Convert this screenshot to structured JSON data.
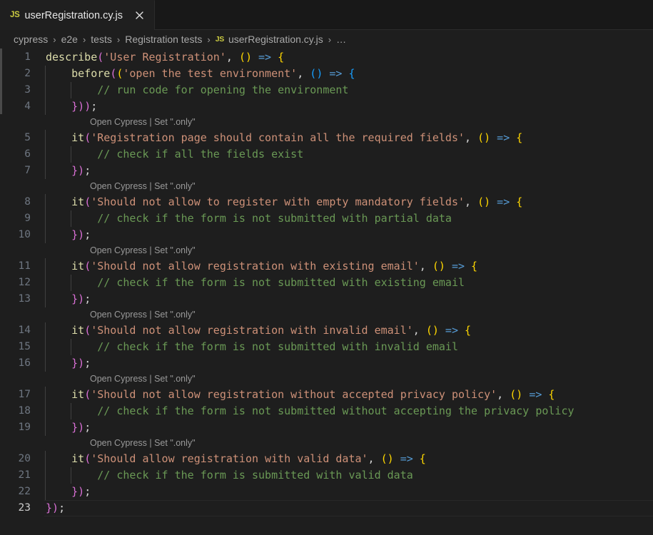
{
  "tab": {
    "icon": "js-file-icon",
    "label": "userRegistration.cy.js",
    "close_icon": "close-icon"
  },
  "breadcrumbs": {
    "separator": "›",
    "items": [
      {
        "label": "cypress",
        "icon": null
      },
      {
        "label": "e2e",
        "icon": null
      },
      {
        "label": "tests",
        "icon": null
      },
      {
        "label": "Registration tests",
        "icon": null
      },
      {
        "label": "userRegistration.cy.js",
        "icon": "js-file-icon"
      },
      {
        "label": "…",
        "icon": null
      }
    ]
  },
  "editor": {
    "language": "javascript",
    "active_line": 23,
    "codelens_label": "Open Cypress | Set \".only\"",
    "lines": [
      {
        "n": 1,
        "text": "describe('User Registration', () => {"
      },
      {
        "n": 2,
        "text": "    before(('open the test environment', () => {"
      },
      {
        "n": 3,
        "text": "        // run code for opening the environment"
      },
      {
        "n": 4,
        "text": "    }));"
      },
      {
        "n": 5,
        "text": "    it('Registration page should contain all the required fields', () => {"
      },
      {
        "n": 6,
        "text": "        // check if all the fields exist"
      },
      {
        "n": 7,
        "text": "    });"
      },
      {
        "n": 8,
        "text": "    it('Should not allow to register with empty mandatory fields', () => {"
      },
      {
        "n": 9,
        "text": "        // check if the form is not submitted with partial data"
      },
      {
        "n": 10,
        "text": "    });"
      },
      {
        "n": 11,
        "text": "    it('Should not allow registration with existing email', () => {"
      },
      {
        "n": 12,
        "text": "        // check if the form is not submitted with existing email"
      },
      {
        "n": 13,
        "text": "    });"
      },
      {
        "n": 14,
        "text": "    it('Should not allow registration with invalid email', () => {"
      },
      {
        "n": 15,
        "text": "        // check if the form is not submitted with invalid email"
      },
      {
        "n": 16,
        "text": "    });"
      },
      {
        "n": 17,
        "text": "    it('Should not allow registration without accepted privacy policy', () => {"
      },
      {
        "n": 18,
        "text": "        // check if the form is not submitted without accepting the privacy policy"
      },
      {
        "n": 19,
        "text": "    });"
      },
      {
        "n": 20,
        "text": "    it('Should allow registration with valid data', () => {"
      },
      {
        "n": 21,
        "text": "        // check if the form is submitted with valid data"
      },
      {
        "n": 22,
        "text": "    });"
      },
      {
        "n": 23,
        "text": "});"
      }
    ],
    "tokens": {
      "function_name": "#dcdcaa",
      "string": "#ce9178",
      "comment": "#6a9955",
      "arrow": "#569cd6",
      "bracket_level_1": "#da70d6",
      "bracket_level_2": "#ffd700",
      "bracket_level_3": "#179fff",
      "plain": "#d4d4d4"
    }
  },
  "theme": {
    "editor_background": "#1e1e1e",
    "tabbar_background": "#181818",
    "active_tab_background": "#1f1f1f",
    "line_number": "#6e7681",
    "line_number_active": "#cccccc",
    "breadcrumb_foreground": "#a9a9a9",
    "codelens_foreground": "#999999",
    "js_icon": "#cbcb41",
    "indent_guide": "#404040"
  }
}
